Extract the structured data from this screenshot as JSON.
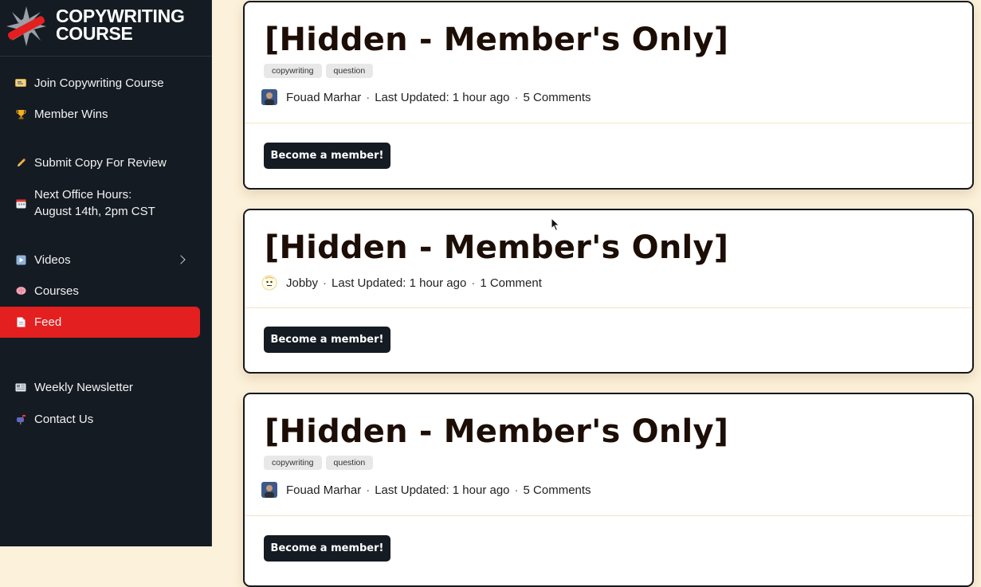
{
  "brand": {
    "line1": "COPYWRITING",
    "line2": "COURSE"
  },
  "sidebar": {
    "items": [
      {
        "label": "Join Copywriting Course",
        "icon": "ticket-icon"
      },
      {
        "label": "Member Wins",
        "icon": "trophy-icon"
      },
      {
        "label": "Submit Copy For Review",
        "icon": "pencil-icon"
      },
      {
        "label_line1": "Next Office Hours:",
        "label_line2": "August 14th, 2pm CST",
        "icon": "calendar-icon"
      },
      {
        "label": "Videos",
        "icon": "play-icon"
      },
      {
        "label": "Courses",
        "icon": "brain-icon"
      },
      {
        "label": "Feed",
        "icon": "document-icon",
        "active": true
      },
      {
        "label": "Weekly Newsletter",
        "icon": "newspaper-icon"
      },
      {
        "label": "Contact Us",
        "icon": "mailbox-icon"
      }
    ]
  },
  "posts": [
    {
      "title": "[Hidden - Member's Only]",
      "tags": [
        "copywriting",
        "question"
      ],
      "author": "Fouad Marhar",
      "updated": "Last Updated: 1 hour ago",
      "comments": "5 Comments",
      "cta": "Become a member!"
    },
    {
      "title": "[Hidden - Member's Only]",
      "tags": [],
      "author": "Jobby",
      "updated": "Last Updated: 1 hour ago",
      "comments": "1 Comment",
      "cta": "Become a member!"
    },
    {
      "title": "[Hidden - Member's Only]",
      "tags": [
        "copywriting",
        "question"
      ],
      "author": "Fouad Marhar",
      "updated": "Last Updated: 1 hour ago",
      "comments": "5 Comments",
      "cta": "Become a member!"
    }
  ],
  "meta_separator": "·",
  "colors": {
    "accent": "#e41f1f",
    "sidebar_bg": "#151b22",
    "page_bg": "#fcf1da"
  }
}
